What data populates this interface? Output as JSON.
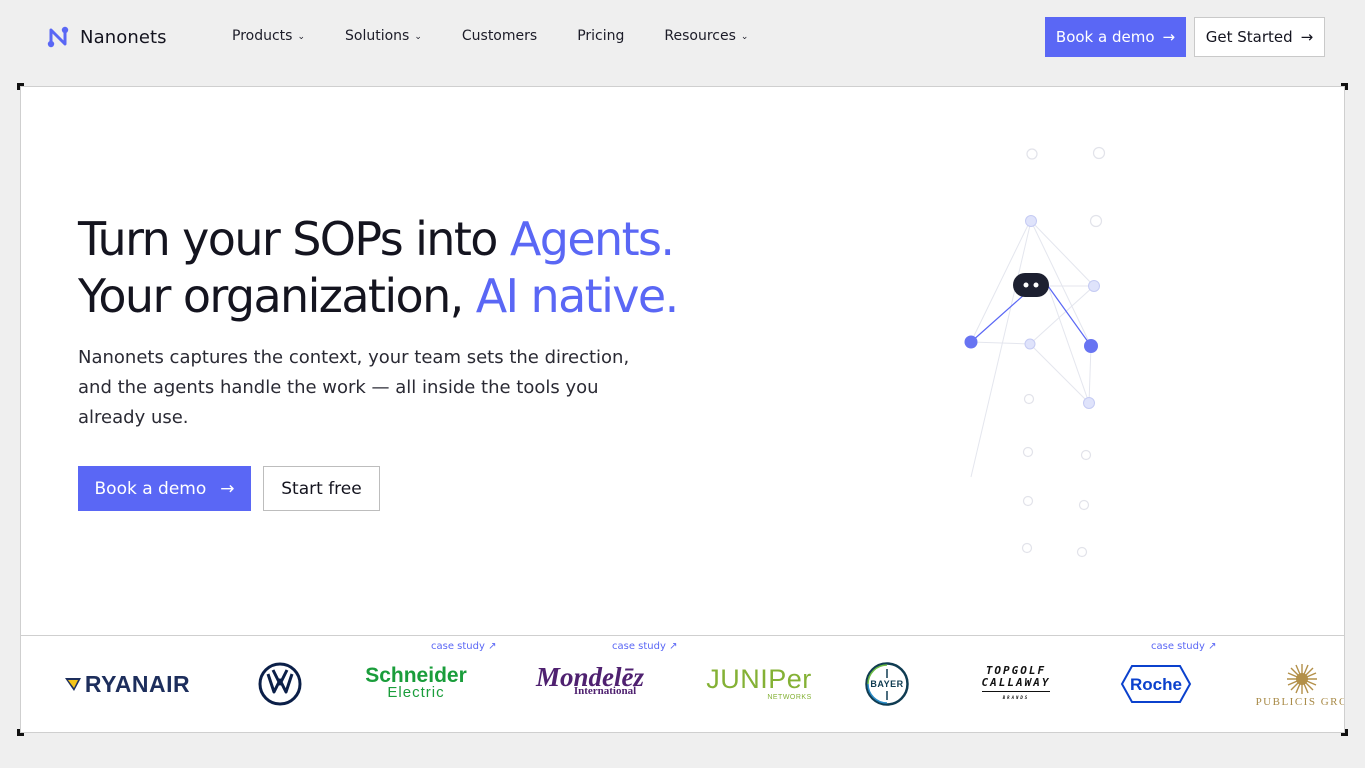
{
  "brand": {
    "name": "Nanonets"
  },
  "nav": [
    {
      "label": "Products",
      "has_dropdown": true
    },
    {
      "label": "Solutions",
      "has_dropdown": true
    },
    {
      "label": "Customers",
      "has_dropdown": false
    },
    {
      "label": "Pricing",
      "has_dropdown": false
    },
    {
      "label": "Resources",
      "has_dropdown": true
    }
  ],
  "header_actions": {
    "demo_label": "Book a demo",
    "start_label": "Get Started"
  },
  "hero": {
    "line1_plain": "Turn your SOPs into ",
    "line1_accent": "Agents.",
    "line2_plain": "Your organization, ",
    "line2_accent": "AI native.",
    "subtitle": "Nanonets captures the context, your team sets the direction, and the agents handle the work — all inside the tools you already use.",
    "demo_label": "Book a demo",
    "free_label": "Start free"
  },
  "logos": [
    {
      "name": "RYANAIR",
      "case_study": false
    },
    {
      "name": "Volkswagen",
      "case_study": false
    },
    {
      "name_a": "Schneider",
      "name_b": "Electric",
      "case_study": true
    },
    {
      "name_a": "Mondelēz",
      "name_b": "International",
      "case_study": true
    },
    {
      "name_a": "JUNIPer",
      "name_b": "NETWORKS",
      "case_study": false
    },
    {
      "name": "BAYER",
      "case_study": false
    },
    {
      "name_a": "TOPGOLF",
      "name_b": "CALLAWAY",
      "name_c": "BRANDS",
      "case_study": false
    },
    {
      "name": "Roche",
      "case_study": true
    },
    {
      "name": "PUBLICIS GRO",
      "case_study": false
    }
  ],
  "case_study_label": "case study ↗",
  "colors": {
    "accent": "#5a67f5",
    "text": "#14141f",
    "background": "#efefef"
  }
}
